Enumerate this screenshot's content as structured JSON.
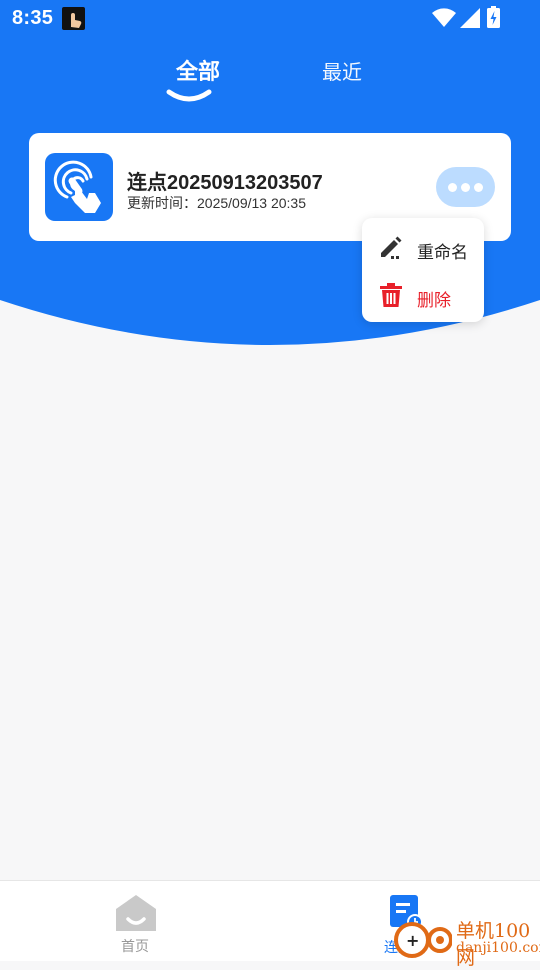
{
  "status_bar": {
    "time": "8:35"
  },
  "tabs": [
    {
      "label": "全部",
      "active": true
    },
    {
      "label": "最近",
      "active": false
    }
  ],
  "card": {
    "title": "连点20250913203507",
    "updated": "更新时间：2025/09/13 20:35",
    "icon": "tap-gesture-icon"
  },
  "popup_menu": {
    "items": [
      {
        "label": "重命名",
        "icon": "pencil-icon"
      },
      {
        "label": "删除",
        "icon": "trash-icon",
        "color": "#e8202a"
      }
    ]
  },
  "bottom_nav": {
    "items": [
      {
        "label": "首页",
        "icon": "home-icon",
        "active": false
      },
      {
        "label": "连点器",
        "icon": "list-clock-icon",
        "active": true
      }
    ]
  },
  "watermark": {
    "title": "单机100网",
    "url": "danji100.com"
  },
  "colors": {
    "primary": "#1877f5",
    "danger": "#e8202a",
    "background": "#f7f7f8"
  }
}
